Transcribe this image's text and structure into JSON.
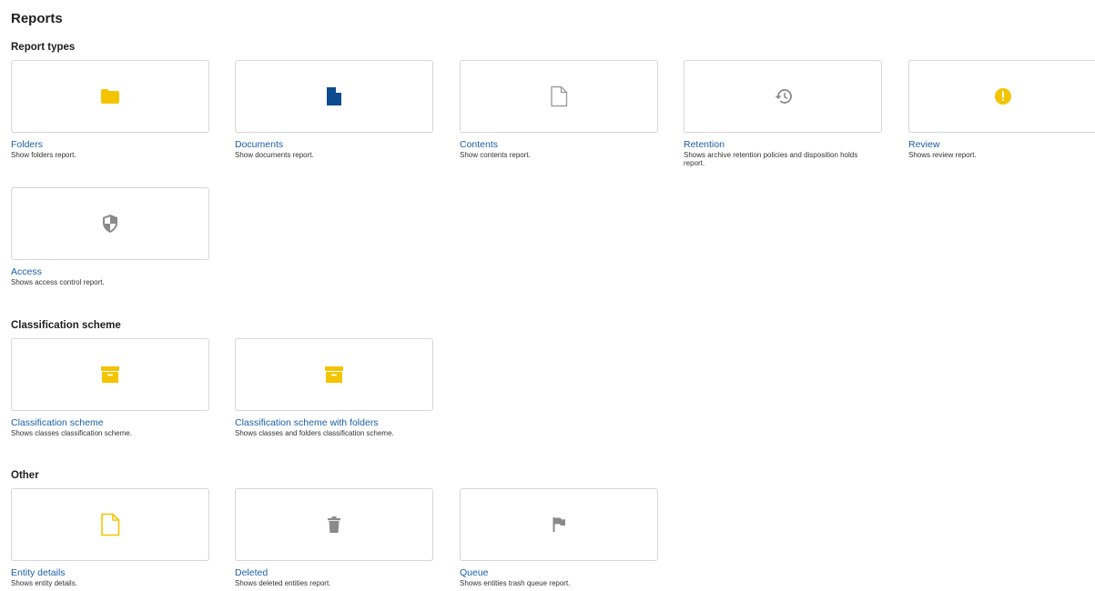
{
  "page": {
    "title": "Reports"
  },
  "sections": {
    "report_types": {
      "title": "Report types",
      "tiles": [
        {
          "title": "Folders",
          "description": "Show folders report.",
          "icon": "folder-icon"
        },
        {
          "title": "Documents",
          "description": "Show documents report.",
          "icon": "document-icon"
        },
        {
          "title": "Contents",
          "description": "Show contents report.",
          "icon": "file-outline-icon"
        },
        {
          "title": "Retention",
          "description": "Shows archive retention policies and disposition holds report.",
          "icon": "history-icon"
        },
        {
          "title": "Review",
          "description": "Shows review report.",
          "icon": "alert-circle-icon"
        },
        {
          "title": "Access",
          "description": "Shows access control report.",
          "icon": "shield-icon"
        }
      ]
    },
    "classification": {
      "title": "Classification scheme",
      "tiles": [
        {
          "title": "Classification scheme",
          "description": "Shows classes classification scheme.",
          "icon": "archive-box-icon"
        },
        {
          "title": "Classification scheme with folders",
          "description": "Shows classes and folders classification scheme.",
          "icon": "archive-box-icon"
        }
      ]
    },
    "other": {
      "title": "Other",
      "tiles": [
        {
          "title": "Entity details",
          "description": "Shows entity details.",
          "icon": "file-outline-icon"
        },
        {
          "title": "Deleted",
          "description": "Shows deleted entities report.",
          "icon": "trash-icon"
        },
        {
          "title": "Queue",
          "description": "Shows entities trash queue report.",
          "icon": "flag-icon"
        }
      ]
    }
  },
  "colors": {
    "yellow": "#f5c400",
    "blue": "#0d4a8f",
    "grey": "#9e9e9e",
    "link": "#1a5fa8",
    "border": "#d6d6d6"
  }
}
